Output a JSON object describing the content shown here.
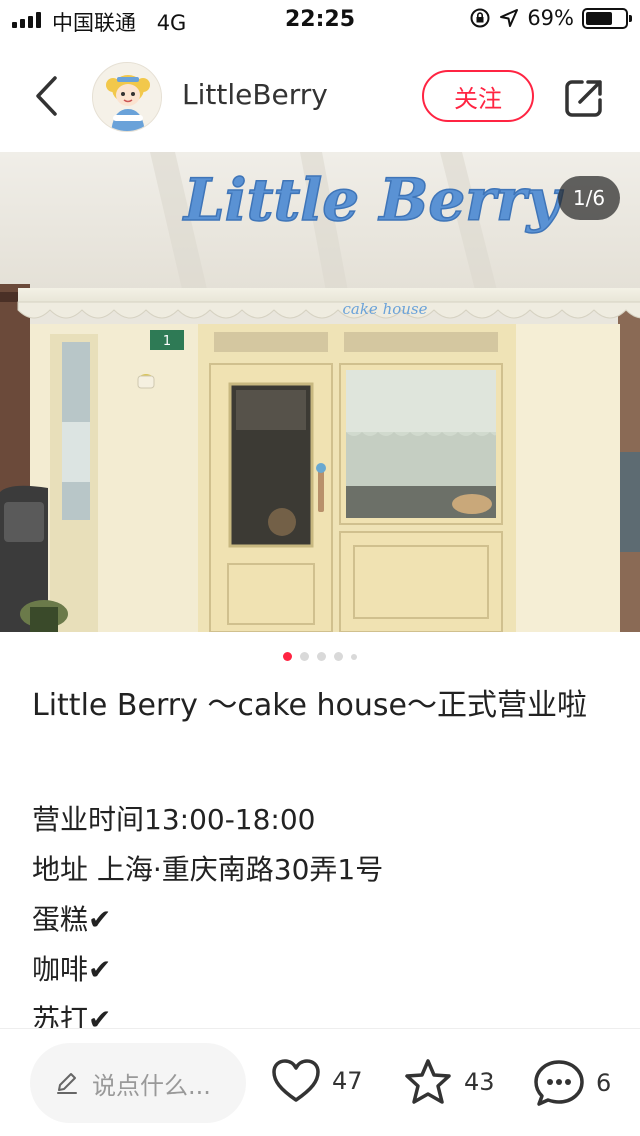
{
  "status_bar": {
    "carrier": "中国联通",
    "network": "4G",
    "time": "22:25",
    "battery": "69%",
    "battery_level": 0.69,
    "icons": [
      "signal-icon",
      "lock-rotation-icon",
      "location-icon",
      "battery-icon"
    ]
  },
  "header": {
    "author_name": "LittleBerry",
    "follow_label": "关注",
    "icons": {
      "back": "back-arrow-icon",
      "share": "share-icon"
    }
  },
  "photo": {
    "sign_text": "Little Berry",
    "awning_text": "cake house",
    "door_number": "1",
    "page_counter": "1/6",
    "current_page": 1,
    "total_pages": 6
  },
  "post": {
    "title": "Little Berry ～cake house～正式营业啦",
    "lines": [
      "营业时间13:00-18:00",
      "地址 上海·重庆南路30弄1号",
      "蛋糕",
      "咖啡",
      "苏打"
    ],
    "check_mark": "✔"
  },
  "bottom_bar": {
    "comment_placeholder": "说点什么...",
    "likes": "47",
    "collects": "43",
    "comments": "6"
  },
  "colors": {
    "accent": "#ff2442",
    "sign_blue": "#5a92d4",
    "facade": "#f3ecd2"
  }
}
